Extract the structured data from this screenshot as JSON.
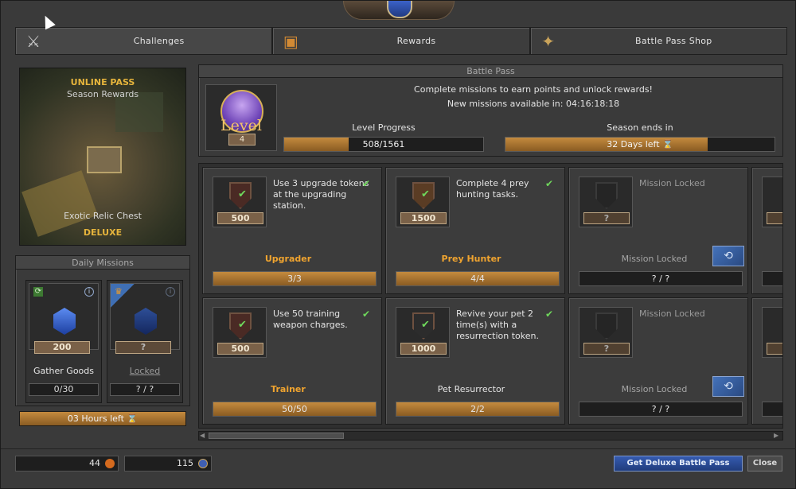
{
  "tabs": [
    {
      "label": "Challenges",
      "icon": "crossed-swords-icon"
    },
    {
      "label": "Rewards",
      "icon": "treasure-chest-icon"
    },
    {
      "label": "Battle Pass Shop",
      "icon": "shop-items-icon"
    }
  ],
  "pass_art": {
    "title": "UNLINE PASS",
    "subtitle": "Season Rewards",
    "caption": "Exotic Relic Chest",
    "tier": "DELUXE"
  },
  "daily": {
    "title": "Daily Missions",
    "cards": [
      {
        "points": "200",
        "label": "Gather Goods",
        "progress": "0/30"
      },
      {
        "points": "?",
        "label": "Locked",
        "progress": "? / ?"
      }
    ],
    "timer": "03 Hours left"
  },
  "battle_pass": {
    "title": "Battle Pass",
    "message": "Complete missions to earn points and unlock rewards!",
    "new_missions": "New missions available in: 04:16:18:18",
    "level_word": "Level",
    "level": "4",
    "level_progress_label": "Level Progress",
    "level_progress_text": "508/1561",
    "level_progress_fraction": 0.325,
    "season_label": "Season ends in",
    "season_text": "32 Days left",
    "season_fraction": 0.75
  },
  "missions": [
    {
      "desc": "Use 3 upgrade tokens at the upgrading station.",
      "points": "500",
      "name": "Upgrader",
      "progress": "3/3",
      "done": true
    },
    {
      "desc": "Complete 4 prey hunting tasks.",
      "points": "1500",
      "name": "Prey Hunter",
      "progress": "4/4",
      "done": true
    },
    {
      "desc": "Mission Locked",
      "points": "?",
      "name": "Mission Locked",
      "progress": "? / ?",
      "done": false
    },
    {
      "desc": "Use 50 training weapon charges.",
      "points": "500",
      "name": "Trainer",
      "progress": "50/50",
      "done": true
    },
    {
      "desc": "Revive your pet 2 time(s) with a resurrection token.",
      "points": "1000",
      "name": "Pet Resurrector",
      "progress": "2/2",
      "done": true
    },
    {
      "desc": "Mission Locked",
      "points": "?",
      "name": "Mission Locked",
      "progress": "? / ?",
      "done": false
    }
  ],
  "footer": {
    "currency1": "44",
    "currency2": "115",
    "deluxe_button": "Get Deluxe Battle Pass",
    "close_button": "Close"
  },
  "colors": {
    "gold": "#f0a42f",
    "bar_fill": "#c48a3e",
    "deluxe_blue": "#355bb0"
  }
}
